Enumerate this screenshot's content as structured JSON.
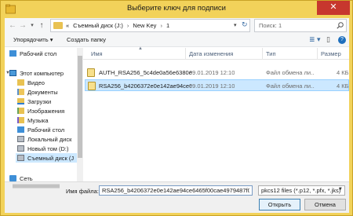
{
  "window": {
    "title": "Выберите ключ для подписи",
    "close_glyph": "✕"
  },
  "address": {
    "prefix": "«",
    "parts": [
      "Съемный диск (J:)",
      "New Key",
      "1"
    ],
    "separator": "›",
    "dropdown_glyph": "▾",
    "refresh_glyph": "↻"
  },
  "search": {
    "placeholder": "Поиск: 1"
  },
  "nav": {
    "back_glyph": "←",
    "forward_glyph": "→",
    "up_glyph": "↑",
    "recent_glyph": "▾"
  },
  "commands": {
    "organize": "Упорядочить ▾",
    "new_folder": "Создать папку",
    "view_glyph": "≣ ▾",
    "pane_glyph": "▯",
    "help_glyph": "?"
  },
  "tree": {
    "items": [
      {
        "label": "Рабочий стол",
        "icon": "desktop-icon"
      },
      {
        "label": "Этот компьютер",
        "icon": "computer-icon"
      },
      {
        "label": "Видео",
        "icon": "video-folder-icon"
      },
      {
        "label": "Документы",
        "icon": "documents-folder-icon"
      },
      {
        "label": "Загрузки",
        "icon": "downloads-folder-icon"
      },
      {
        "label": "Изображения",
        "icon": "pictures-folder-icon"
      },
      {
        "label": "Музыка",
        "icon": "music-folder-icon"
      },
      {
        "label": "Рабочий стол",
        "icon": "desktop-icon"
      },
      {
        "label": "Локальный диск",
        "icon": "drive-icon"
      },
      {
        "label": "Новый том (D:)",
        "icon": "drive-icon"
      },
      {
        "label": "Съемный диск (J",
        "icon": "removable-drive-icon"
      },
      {
        "label": "Сеть",
        "icon": "network-icon"
      }
    ]
  },
  "columns": {
    "name": "Имя",
    "date": "Дата изменения",
    "type": "Тип",
    "size": "Размер"
  },
  "files": [
    {
      "name": "AUTH_RSA256_5c4de0a56e6380e9f17037...",
      "date": "09.01.2019 12:10",
      "type": "Файл обмена ли...",
      "size": "4 КБ",
      "selected": false
    },
    {
      "name": "RSA256_b4206372e0e142ae94ce6465f00ca...",
      "date": "09.01.2019 12:10",
      "type": "Файл обмена ли...",
      "size": "4 КБ",
      "selected": true
    }
  ],
  "bottom": {
    "filename_label": "Имя файла:",
    "filename_value": "RSA256_b4206372e0e142ae94ce6465f00cae4979487f08",
    "filetype": "pkcs12 files (*.p12, *.pfx, *.jks)",
    "open_button": "Открыть",
    "cancel_button": "Отмена"
  }
}
